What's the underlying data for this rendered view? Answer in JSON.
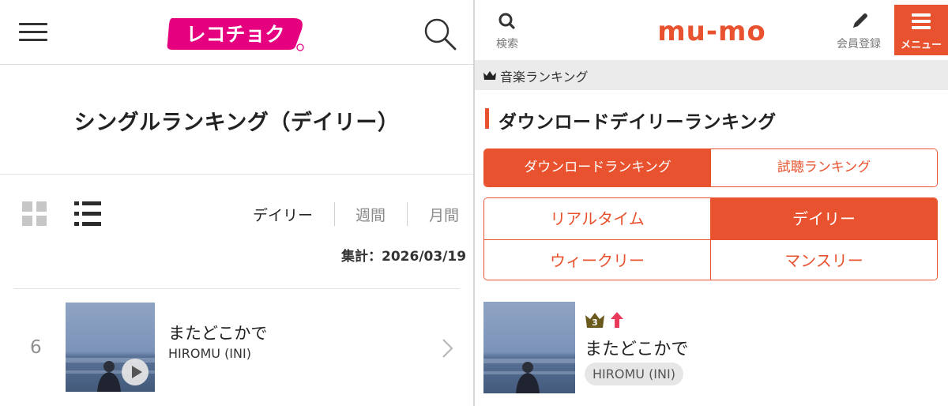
{
  "left": {
    "logo_text": "レコチョク",
    "logo_color": "#e4007f",
    "title": "シングルランキング（デイリー）",
    "periods": [
      {
        "label": "デイリー",
        "active": true
      },
      {
        "label": "週間",
        "active": false
      },
      {
        "label": "月間",
        "active": false
      }
    ],
    "aggregation": "集計：2026/03/19",
    "rows": [
      {
        "rank": "6",
        "title": "またどこかで",
        "artist": "HIROMU (INI)"
      }
    ],
    "icons": [
      "hamburger-icon",
      "search-icon",
      "grid-view-icon",
      "list-view-icon",
      "play-icon",
      "chevron-right-icon"
    ]
  },
  "right": {
    "search_label": "検索",
    "logo_text": "mu-mo",
    "accent_color": "#e8522f",
    "member_label": "会員登録",
    "menu_label": "メニュー",
    "breadcrumb": "音楽ランキング",
    "heading": "ダウンロードデイリーランキング",
    "tabs_primary": [
      {
        "label": "ダウンロードランキング",
        "active": true
      },
      {
        "label": "試聴ランキング",
        "active": false
      }
    ],
    "tabs_period": [
      {
        "label": "リアルタイム",
        "active": false
      },
      {
        "label": "デイリー",
        "active": true
      },
      {
        "label": "ウィークリー",
        "active": false
      },
      {
        "label": "マンスリー",
        "active": false
      }
    ],
    "rows": [
      {
        "rank": "3",
        "trend": "up",
        "title": "またどこかで",
        "artist": "HIROMU (INI)"
      }
    ],
    "icons": [
      "search-icon",
      "pencil-icon",
      "menu-icon",
      "crown-icon",
      "rank-crown-icon",
      "arrow-up-icon"
    ]
  }
}
